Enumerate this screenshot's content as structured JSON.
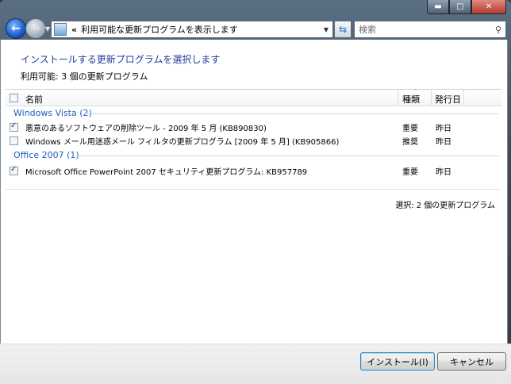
{
  "window": {
    "min_label": "▬",
    "max_label": "□",
    "close_label": "✕"
  },
  "nav": {
    "address_prefix": "«",
    "address_text": "利用可能な更新プログラムを表示します",
    "search_placeholder": "検索"
  },
  "page": {
    "heading": "インストールする更新プログラムを選択します",
    "available": "利用可能: 3 個の更新プログラム"
  },
  "columns": {
    "name": "名前",
    "type": "種類",
    "published": "発行日"
  },
  "groups": [
    {
      "title": "Windows Vista (2)",
      "updates": [
        {
          "name": "悪意のあるソフトウェアの削除ツール - 2009 年 5 月 (KB890830)",
          "type": "重要",
          "published": "昨日",
          "checked": true
        },
        {
          "name": "Windows メール用迷惑メール フィルタの更新プログラム [2009 年 5 月] (KB905866)",
          "type": "推奨",
          "published": "昨日",
          "checked": false
        }
      ]
    },
    {
      "title": "Office 2007 (1)",
      "updates": [
        {
          "name": "Microsoft Office PowerPoint 2007 セキュリティ更新プログラム: KB957789",
          "type": "重要",
          "published": "昨日",
          "checked": true
        }
      ]
    }
  ],
  "selected_summary": "選択: 2 個の更新プログラム",
  "buttons": {
    "install": "インストール(I)",
    "cancel": "キャンセル"
  },
  "colors": {
    "heading": "#1f3e96",
    "group": "#1f5fbf",
    "frame": "#3d4c5c"
  }
}
